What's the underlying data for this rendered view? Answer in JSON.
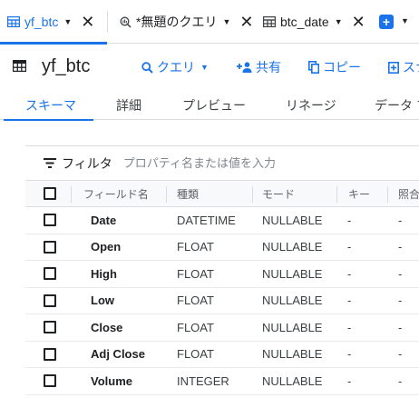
{
  "tabs": [
    {
      "label": "yf_btc",
      "icon": "table-icon",
      "active": true
    },
    {
      "label": "*無題のクエリ",
      "icon": "query-icon",
      "active": false
    },
    {
      "label": "btc_date",
      "icon": "table-icon",
      "active": false
    }
  ],
  "header": {
    "title": "yf_btc",
    "actions": {
      "query": "クエリ",
      "share": "共有",
      "copy": "コピー",
      "snapshot": "スナ"
    }
  },
  "subtabs": [
    "スキーマ",
    "詳細",
    "プレビュー",
    "リネージ",
    "データ プ"
  ],
  "filter": {
    "label": "フィルタ",
    "placeholder": "プロパティ名または値を入力"
  },
  "table": {
    "headers": [
      "フィールド名",
      "種類",
      "モード",
      "キー",
      "照合"
    ],
    "rows": [
      {
        "name": "Date",
        "type": "DATETIME",
        "mode": "NULLABLE",
        "key": "-",
        "collation": "-"
      },
      {
        "name": "Open",
        "type": "FLOAT",
        "mode": "NULLABLE",
        "key": "-",
        "collation": "-"
      },
      {
        "name": "High",
        "type": "FLOAT",
        "mode": "NULLABLE",
        "key": "-",
        "collation": "-"
      },
      {
        "name": "Low",
        "type": "FLOAT",
        "mode": "NULLABLE",
        "key": "-",
        "collation": "-"
      },
      {
        "name": "Close",
        "type": "FLOAT",
        "mode": "NULLABLE",
        "key": "-",
        "collation": "-"
      },
      {
        "name": "Adj Close",
        "type": "FLOAT",
        "mode": "NULLABLE",
        "key": "-",
        "collation": "-"
      },
      {
        "name": "Volume",
        "type": "INTEGER",
        "mode": "NULLABLE",
        "key": "-",
        "collation": "-"
      }
    ]
  },
  "colors": {
    "accent": "#1a73e8",
    "text": "#202124",
    "border": "#dadce0"
  }
}
